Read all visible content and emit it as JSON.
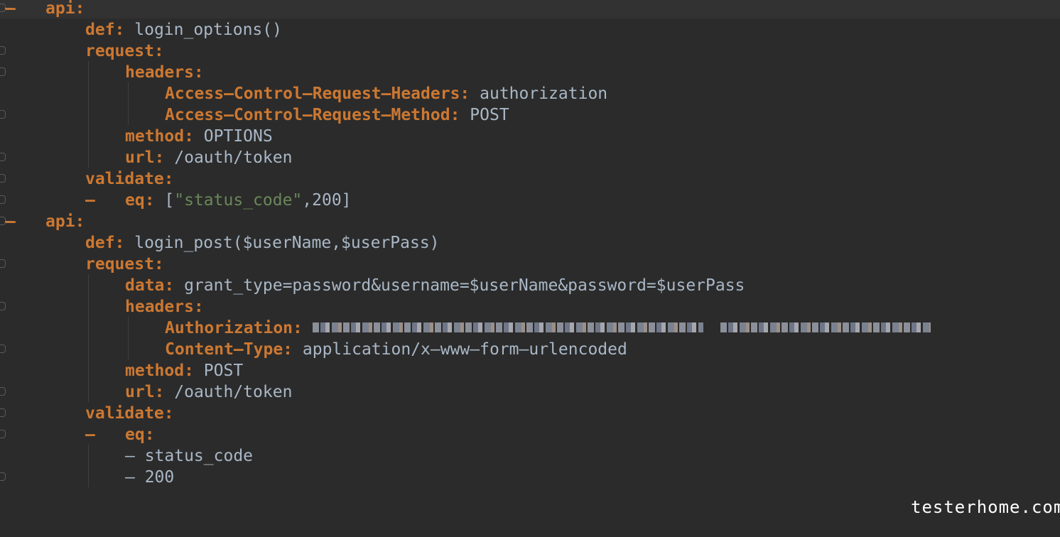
{
  "code": {
    "api_key": "api:",
    "def_key": "def:",
    "request_key": "request:",
    "headers_key": "headers:",
    "method_key": "method:",
    "url_key": "url:",
    "validate_key": "validate:",
    "eq_key": "eq:",
    "data_key": "data:",
    "dash": "–",
    "block1": {
      "def_value": "login_options()",
      "header1_key": "Access–Control–Request–Headers:",
      "header1_value": "authorization",
      "header2_key": "Access–Control–Request–Method:",
      "header2_value": "POST",
      "method_value": "OPTIONS",
      "url_value": "/oauth/token",
      "eq_open": "[",
      "eq_string": "\"status_code\"",
      "eq_rest": ",200]"
    },
    "block2": {
      "def_value": "login_post($userName,$userPass)",
      "data_value": "grant_type=password&username=$userName&password=$userPass",
      "auth_key": "Authorization:",
      "content_type_key": "Content–Type:",
      "content_type_value": "application/x–www–form–urlencoded",
      "method_value": "POST",
      "url_value": "/oauth/token",
      "list_item1": "– status_code",
      "list_item2": "– 200"
    }
  },
  "watermark": "testerhome.com"
}
